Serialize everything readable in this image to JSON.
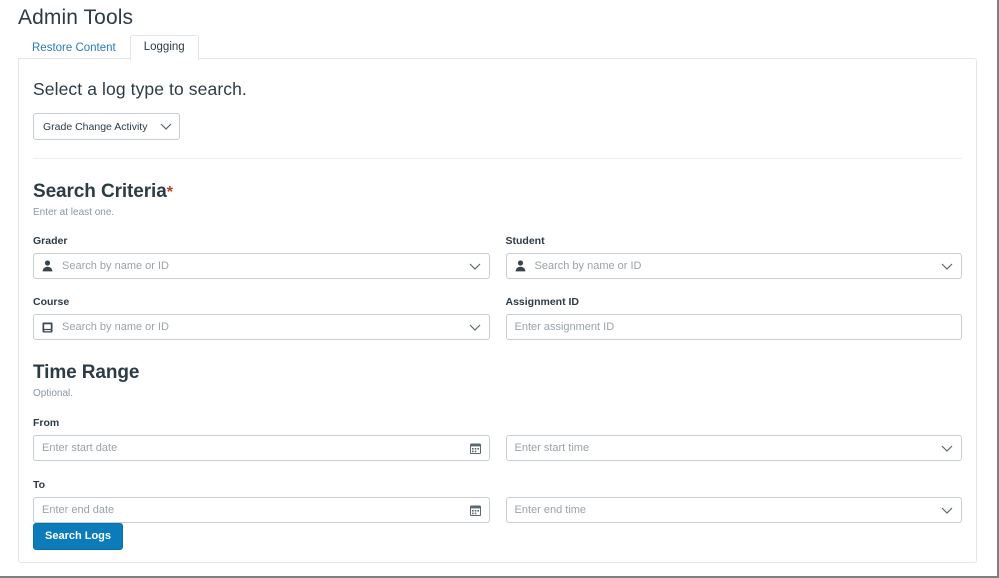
{
  "page": {
    "title": "Admin Tools"
  },
  "tabs": [
    {
      "label": "Restore Content",
      "active": false,
      "name": "tab-restore-content"
    },
    {
      "label": "Logging",
      "active": true,
      "name": "tab-logging"
    }
  ],
  "log_type": {
    "heading": "Select a log type to search.",
    "selected": "Grade Change Activity",
    "chevron_icon": "chevron-down-icon"
  },
  "search_criteria": {
    "heading": "Search Criteria",
    "required_marker": "*",
    "subtitle": "Enter at least one.",
    "fields": [
      {
        "name": "grader",
        "label": "Grader",
        "placeholder": "Search by name or ID",
        "value": "",
        "left_icon": "user-icon",
        "right_icon": "chevron-down-icon"
      },
      {
        "name": "student",
        "label": "Student",
        "placeholder": "Search by name or ID",
        "value": "",
        "left_icon": "user-icon",
        "right_icon": "chevron-down-icon"
      },
      {
        "name": "course",
        "label": "Course",
        "placeholder": "Search by name or ID",
        "value": "",
        "left_icon": "course-book-icon",
        "right_icon": "chevron-down-icon"
      },
      {
        "name": "assignment-id",
        "label": "Assignment ID",
        "placeholder": "Enter assignment ID",
        "value": "",
        "left_icon": "",
        "right_icon": ""
      }
    ]
  },
  "time_range": {
    "heading": "Time Range",
    "subtitle": "Optional.",
    "from_label": "From",
    "to_label": "To",
    "fields": [
      {
        "name": "start-date",
        "placeholder": "Enter start date",
        "value": "",
        "right_icon": "calendar-icon"
      },
      {
        "name": "start-time",
        "placeholder": "Enter start time",
        "value": "",
        "right_icon": "chevron-down-icon"
      },
      {
        "name": "end-date",
        "placeholder": "Enter end date",
        "value": "",
        "right_icon": "calendar-icon"
      },
      {
        "name": "end-time",
        "placeholder": "Enter end time",
        "value": "",
        "right_icon": "chevron-down-icon"
      }
    ]
  },
  "actions": {
    "search_logs_label": "Search Logs"
  },
  "colors": {
    "accent_blue": "#0b7bba",
    "link_blue": "#2b7abc",
    "required_red": "#c0392b",
    "text": "#2d3b45",
    "placeholder": "#9aa3a9",
    "border": "#c7cdd1",
    "panel_border": "#e3e6e8"
  }
}
